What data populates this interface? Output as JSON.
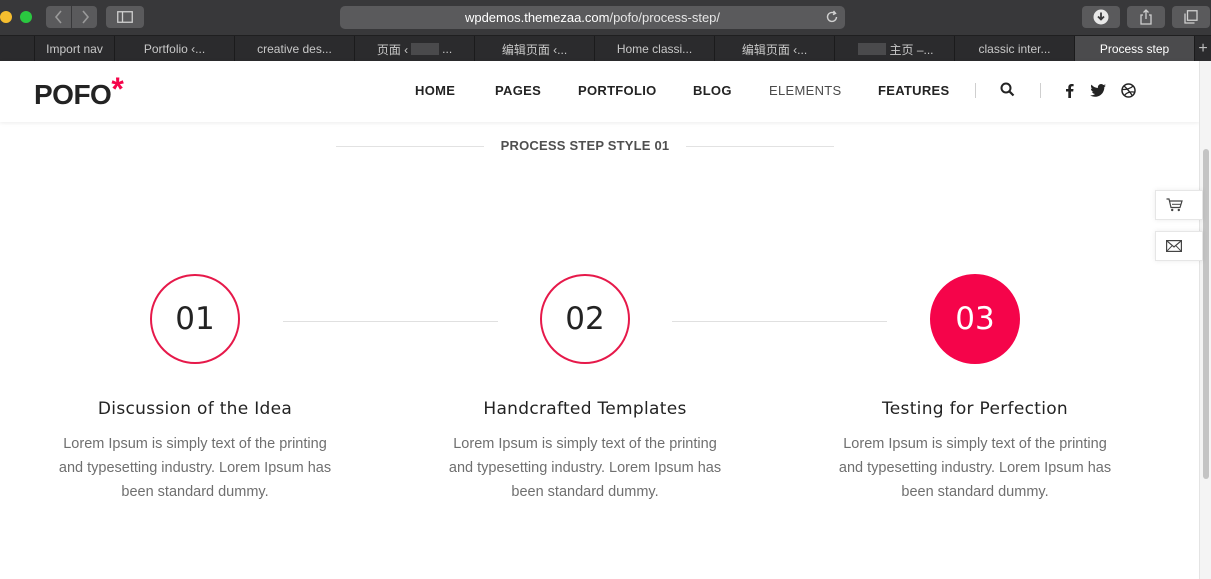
{
  "browser": {
    "url_domain": "wpdemos.themezaa.com",
    "url_path": "/pofo/process-step/",
    "tabs": [
      {
        "label": "Import nav"
      },
      {
        "label": "Portfolio ‹..."
      },
      {
        "label": "creative des..."
      },
      {
        "label_prefix": "页面 ‹",
        "label_suffix": "..."
      },
      {
        "label": "编辑页面 ‹..."
      },
      {
        "label": "Home classi..."
      },
      {
        "label": "编辑页面 ‹..."
      },
      {
        "label": "主页 –..."
      },
      {
        "label": "classic inter..."
      },
      {
        "label": "Process step"
      }
    ],
    "new_tab": "+"
  },
  "header": {
    "logo_text": "POFO",
    "logo_mark": "*",
    "menu": [
      "HOME",
      "PAGES",
      "PORTFOLIO",
      "BLOG",
      "ELEMENTS",
      "FEATURES"
    ],
    "icons": [
      "search-icon",
      "facebook-icon",
      "twitter-icon",
      "dribbble-icon"
    ]
  },
  "side_buttons": [
    "cart-icon",
    "mail-icon"
  ],
  "section": {
    "title": "PROCESS STEP STYLE 01"
  },
  "steps": [
    {
      "number": "01",
      "title": "Discussion of the Idea",
      "text_lines": [
        "Lorem Ipsum is simply text of the printing",
        "and typesetting industry. Lorem Ipsum has",
        "been standard dummy."
      ]
    },
    {
      "number": "02",
      "title": "Handcrafted Templates",
      "text_lines": [
        "Lorem Ipsum is simply text of the printing",
        "and typesetting industry. Lorem Ipsum has",
        "been standard dummy."
      ]
    },
    {
      "number": "03",
      "title": "Testing for Perfection",
      "text_lines": [
        "Lorem Ipsum is simply text of the printing",
        "and typesetting industry. Lorem Ipsum has",
        "been standard dummy."
      ]
    }
  ],
  "colors": {
    "accent": "#f5044a",
    "heading": "#232323",
    "body_text": "#6f6f6f"
  }
}
